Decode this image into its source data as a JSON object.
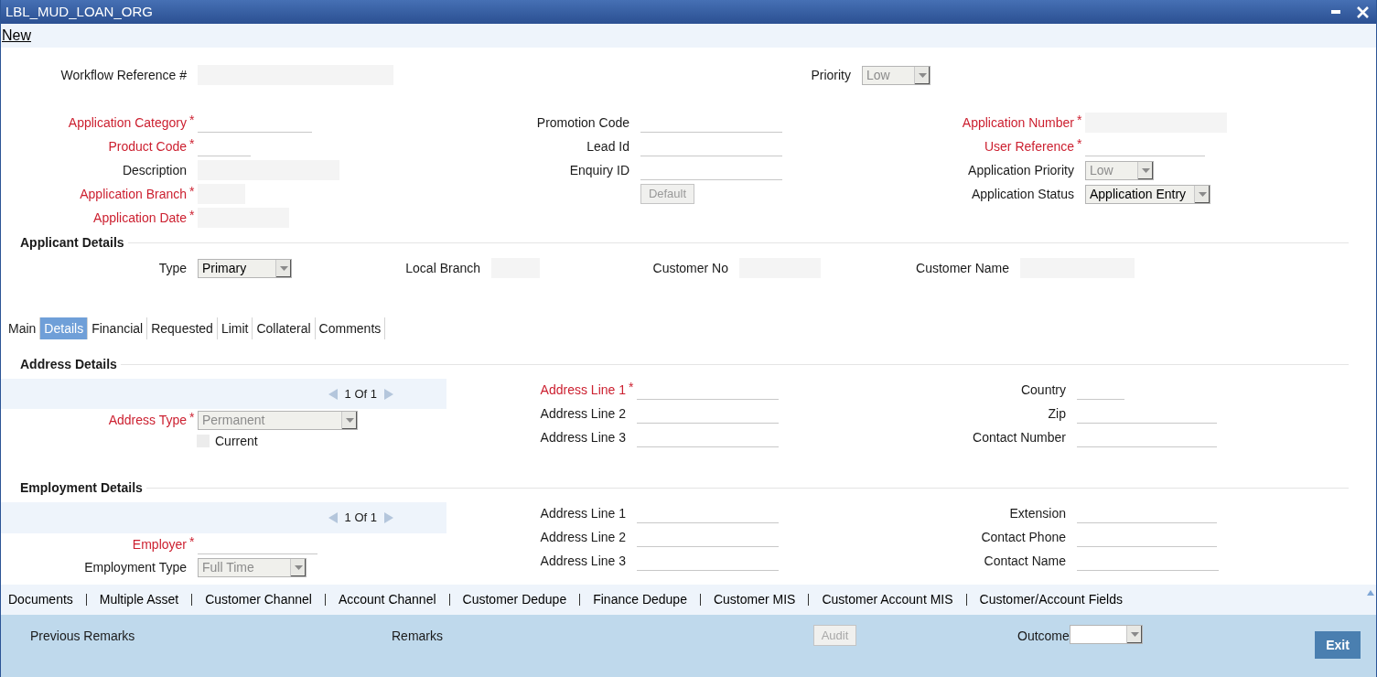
{
  "window": {
    "title": "LBL_MUD_LOAN_ORG"
  },
  "toolbar": {
    "new_link": "New"
  },
  "required_mark": "*",
  "header": [
    {
      "label": "Workflow Reference #",
      "required": false,
      "kind": "box"
    },
    {
      "label": "Priority",
      "required": false,
      "kind": "select",
      "value": "Low",
      "disabled": true
    }
  ],
  "application": {
    "columns": [
      [
        {
          "label": "Application Category",
          "required": true,
          "kind": "text"
        },
        {
          "label": "Product Code",
          "required": true,
          "kind": "text"
        },
        {
          "label": "Description",
          "required": false,
          "kind": "box"
        },
        {
          "label": "Application Branch",
          "required": true,
          "kind": "box"
        },
        {
          "label": "Application Date",
          "required": true,
          "kind": "box"
        }
      ],
      [
        {
          "label": "Promotion Code",
          "required": false,
          "kind": "text"
        },
        {
          "label": "Lead Id",
          "required": false,
          "kind": "text"
        },
        {
          "label": "Enquiry ID",
          "required": false,
          "kind": "text"
        },
        {
          "label": "Default",
          "kind": "button",
          "disabled": true
        }
      ],
      [
        {
          "label": "Application Number",
          "required": true,
          "kind": "box"
        },
        {
          "label": "User Reference",
          "required": true,
          "kind": "text"
        },
        {
          "label": "Application Priority",
          "required": false,
          "kind": "select",
          "value": "Low",
          "disabled": true
        },
        {
          "label": "Application Status",
          "required": false,
          "kind": "select",
          "value": "Application Entry",
          "disabled": false
        }
      ]
    ]
  },
  "applicant_details": {
    "title": "Applicant Details",
    "fields": [
      {
        "label": "Type",
        "required": false,
        "kind": "select",
        "value": "Primary",
        "disabled": false
      },
      {
        "label": "Local Branch",
        "required": false,
        "kind": "box"
      },
      {
        "label": "Customer No",
        "required": false,
        "kind": "box"
      },
      {
        "label": "Customer Name",
        "required": false,
        "kind": "box"
      }
    ]
  },
  "tabs": [
    {
      "label": "Main",
      "selected": false
    },
    {
      "label": "Details",
      "selected": true
    },
    {
      "label": "Financial",
      "selected": false
    },
    {
      "label": "Requested",
      "selected": false
    },
    {
      "label": "Limit",
      "selected": false
    },
    {
      "label": "Collateral",
      "selected": false
    },
    {
      "label": "Comments",
      "selected": false
    }
  ],
  "address_details": {
    "title": "Address Details",
    "pager": "1 Of 1",
    "left": [
      {
        "label": "Address Type",
        "required": true,
        "kind": "select",
        "value": "Permanent",
        "disabled": true
      },
      {
        "label": "Current",
        "kind": "checkbox",
        "checked": false
      }
    ],
    "middle": [
      {
        "label": "Address Line 1",
        "required": true,
        "kind": "text"
      },
      {
        "label": "Address Line 2",
        "required": false,
        "kind": "text"
      },
      {
        "label": "Address Line 3",
        "required": false,
        "kind": "text"
      }
    ],
    "right": [
      {
        "label": "Country",
        "required": false,
        "kind": "text"
      },
      {
        "label": "Zip",
        "required": false,
        "kind": "text"
      },
      {
        "label": "Contact Number",
        "required": false,
        "kind": "text"
      }
    ]
  },
  "employment_details": {
    "title": "Employment Details",
    "pager": "1 Of 1",
    "left": [
      {
        "label": "Employer",
        "required": true,
        "kind": "text"
      },
      {
        "label": "Employment Type",
        "required": false,
        "kind": "select",
        "value": "Full Time",
        "disabled": true
      }
    ],
    "middle": [
      {
        "label": "Address Line 1",
        "required": false,
        "kind": "text"
      },
      {
        "label": "Address Line 2",
        "required": false,
        "kind": "text"
      },
      {
        "label": "Address Line 3",
        "required": false,
        "kind": "text"
      }
    ],
    "right": [
      {
        "label": "Extension",
        "required": false,
        "kind": "text"
      },
      {
        "label": "Contact Phone",
        "required": false,
        "kind": "text"
      },
      {
        "label": "Contact Name",
        "required": false,
        "kind": "text"
      }
    ]
  },
  "bottom_links": [
    "Documents",
    "Multiple Asset",
    "Customer Channel",
    "Account Channel",
    "Customer Dedupe",
    "Finance Dedupe",
    "Customer MIS",
    "Customer Account MIS",
    "Customer/Account Fields"
  ],
  "footer": {
    "previous_remarks": "Previous Remarks",
    "remarks": "Remarks",
    "audit": {
      "label": "Audit",
      "disabled": true
    },
    "outcome": {
      "label": "Outcome",
      "disabled": false
    },
    "exit": {
      "label": "Exit",
      "disabled": false
    }
  }
}
